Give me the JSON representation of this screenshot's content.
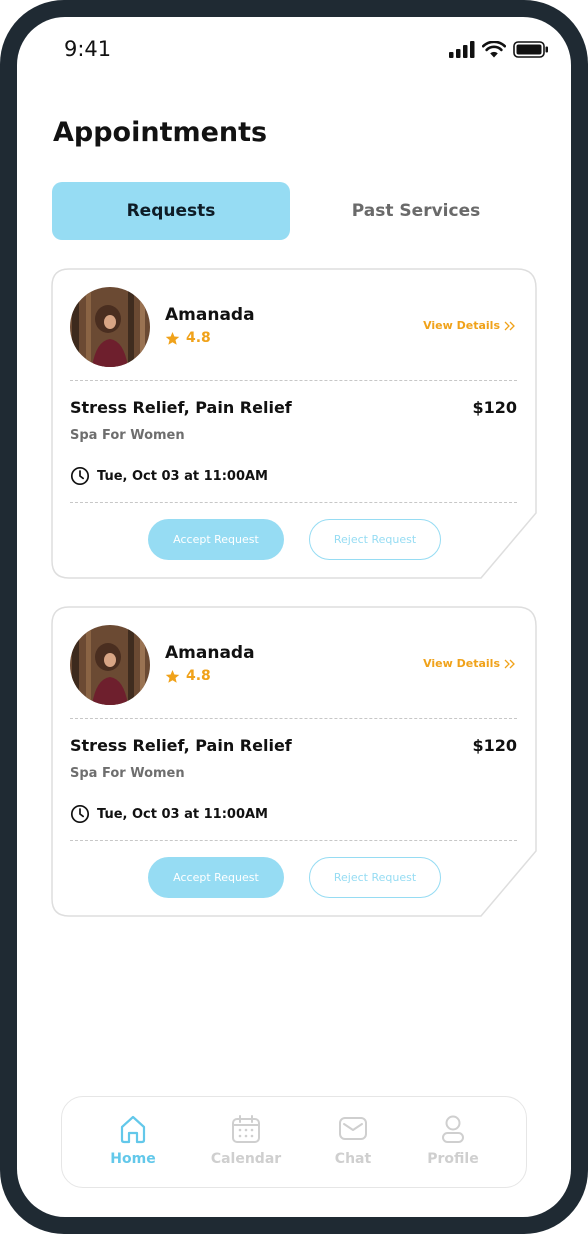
{
  "status_bar": {
    "time": "9:41"
  },
  "page": {
    "title": "Appointments"
  },
  "tabs": [
    {
      "label": "Requests",
      "active": true
    },
    {
      "label": "Past Services",
      "active": false
    }
  ],
  "appointments": [
    {
      "client_name": "Amanada",
      "rating": "4.8",
      "view_details_label": "View Details",
      "service": "Stress Relief, Pain Relief",
      "price": "$120",
      "category": "Spa For Women",
      "datetime": "Tue, Oct 03 at 11:00AM",
      "accept_label": "Accept Request",
      "reject_label": "Reject Request"
    },
    {
      "client_name": "Amanada",
      "rating": "4.8",
      "view_details_label": "View Details",
      "service": "Stress Relief, Pain Relief",
      "price": "$120",
      "category": "Spa For Women",
      "datetime": "Tue, Oct 03 at 11:00AM",
      "accept_label": "Accept Request",
      "reject_label": "Reject Request"
    }
  ],
  "bottom_nav": [
    {
      "label": "Home",
      "icon": "home-icon",
      "active": true
    },
    {
      "label": "Calendar",
      "icon": "calendar-icon",
      "active": false
    },
    {
      "label": "Chat",
      "icon": "chat-icon",
      "active": false
    },
    {
      "label": "Profile",
      "icon": "profile-icon",
      "active": false
    }
  ],
  "colors": {
    "accent": "#96dcf3",
    "accent_text": "#63c8ea",
    "rating": "#f0a21a",
    "frame": "#1f2a33"
  }
}
